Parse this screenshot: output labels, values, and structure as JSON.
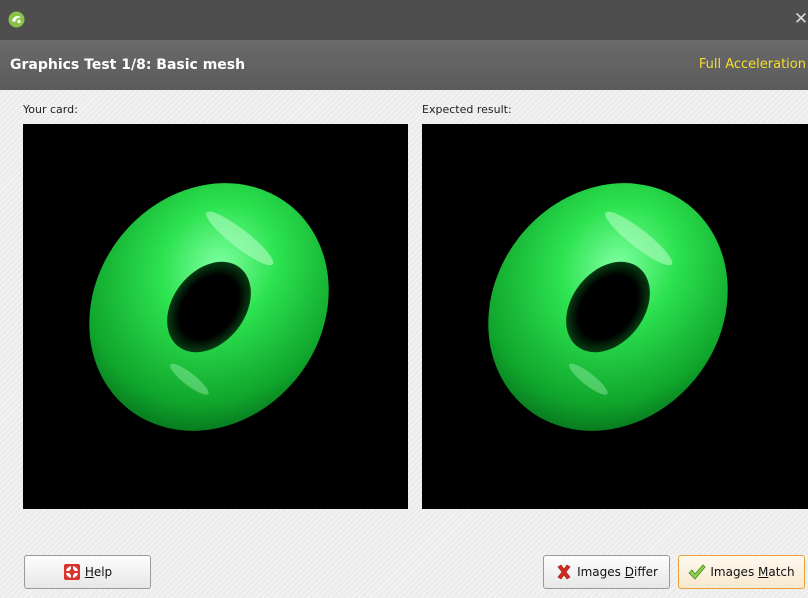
{
  "window": {
    "close_glyph": "✕",
    "app_icon": "leapfrog-icon"
  },
  "header": {
    "title": "Graphics Test 1/8: Basic mesh",
    "status": "Full Acceleration",
    "status_color": "#f6df2c"
  },
  "panels": {
    "left_label": "Your card:",
    "right_label": "Expected result:",
    "render_color": "#22e04a",
    "background_color": "#000000"
  },
  "buttons": {
    "help": {
      "label": "Help",
      "mnemonic": "H",
      "rest": "elp",
      "icon": "lifebuoy-icon"
    },
    "differ": {
      "pre": "Images ",
      "mnemonic": "D",
      "rest": "iffer",
      "icon": "red-x-icon"
    },
    "match": {
      "pre": "Images ",
      "mnemonic": "M",
      "rest": "atch",
      "icon": "green-check-icon"
    }
  }
}
